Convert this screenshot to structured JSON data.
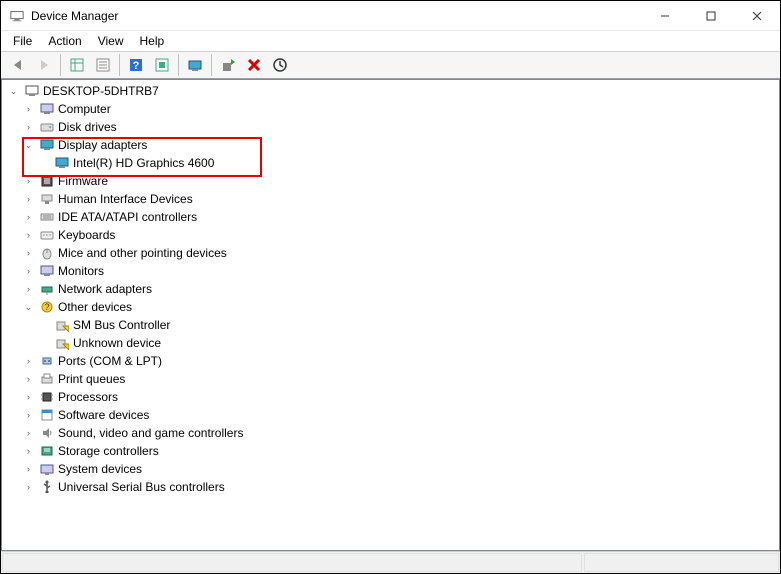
{
  "window": {
    "title": "Device Manager"
  },
  "menu": {
    "file": "File",
    "action": "Action",
    "view": "View",
    "help": "Help"
  },
  "tree": {
    "root": "DESKTOP-5DHTRB7",
    "computer": "Computer",
    "disk_drives": "Disk drives",
    "display_adapters": "Display adapters",
    "display_child": "Intel(R) HD Graphics 4600",
    "firmware": "Firmware",
    "hid": "Human Interface Devices",
    "ide": "IDE ATA/ATAPI controllers",
    "keyboards": "Keyboards",
    "mice": "Mice and other pointing devices",
    "monitors": "Monitors",
    "network": "Network adapters",
    "other_devices": "Other devices",
    "sm_bus": "SM Bus Controller",
    "unknown": "Unknown device",
    "ports": "Ports (COM & LPT)",
    "print_queues": "Print queues",
    "processors": "Processors",
    "software_devices": "Software devices",
    "sound": "Sound, video and game controllers",
    "storage": "Storage controllers",
    "system_devices": "System devices",
    "usb": "Universal Serial Bus controllers"
  }
}
